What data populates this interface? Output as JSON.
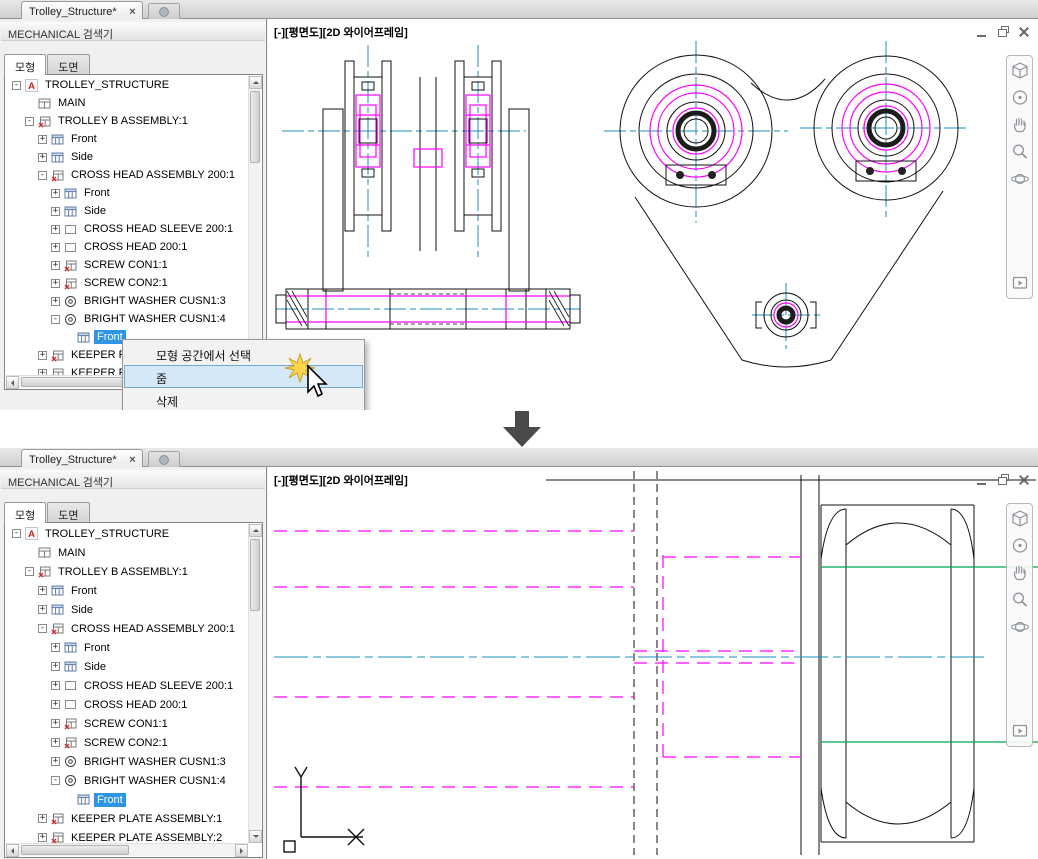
{
  "colors": {
    "magenta": "#ff00ff",
    "centerline": "#1b8fbe",
    "green": "#00a550",
    "selection": "#2e95e5",
    "menu_highlight": "#d5e8f8"
  },
  "tab": {
    "title": "Trolley_Structure*",
    "close_glyph": "×"
  },
  "browser": {
    "title": "MECHANICAL 검색기",
    "tabs": [
      {
        "label": "모형",
        "active": true
      },
      {
        "label": "도면",
        "active": false
      }
    ],
    "tree": [
      {
        "label": "TROLLEY_STRUCTURE",
        "level": 0,
        "toggle": "minus",
        "icon": "dwg-file-icon",
        "selected": false
      },
      {
        "label": "MAIN",
        "level": 1,
        "toggle": null,
        "icon": "layout-icon",
        "selected": false
      },
      {
        "label": "TROLLEY B ASSEMBLY:1",
        "level": 1,
        "toggle": "minus",
        "icon": "assembly-icon",
        "selected": false
      },
      {
        "label": "Front",
        "level": 2,
        "toggle": "plus",
        "icon": "view-icon",
        "selected": false
      },
      {
        "label": "Side",
        "level": 2,
        "toggle": "plus",
        "icon": "view-icon",
        "selected": false
      },
      {
        "label": "CROSS HEAD ASSEMBLY 200:1",
        "level": 2,
        "toggle": "minus",
        "icon": "assembly-icon",
        "selected": false
      },
      {
        "label": "Front",
        "level": 3,
        "toggle": "plus",
        "icon": "view-icon",
        "selected": false
      },
      {
        "label": "Side",
        "level": 3,
        "toggle": "plus",
        "icon": "view-icon",
        "selected": false
      },
      {
        "label": "CROSS HEAD SLEEVE 200:1",
        "level": 3,
        "toggle": "plus",
        "icon": "part-icon",
        "selected": false
      },
      {
        "label": "CROSS HEAD 200:1",
        "level": 3,
        "toggle": "plus",
        "icon": "part-icon",
        "selected": false
      },
      {
        "label": "SCREW CON1:1",
        "level": 3,
        "toggle": "plus",
        "icon": "assembly-icon",
        "selected": false
      },
      {
        "label": "SCREW CON2:1",
        "level": 3,
        "toggle": "plus",
        "icon": "assembly-icon",
        "selected": false
      },
      {
        "label": "BRIGHT WASHER CUSN1:3",
        "level": 3,
        "toggle": "plus",
        "icon": "washer-icon",
        "selected": false
      },
      {
        "label": "BRIGHT WASHER CUSN1:4",
        "level": 3,
        "toggle": "minus",
        "icon": "washer-icon",
        "selected": false
      },
      {
        "label": "Front",
        "level": 4,
        "toggle": null,
        "icon": "view-icon",
        "selected": true
      },
      {
        "label": "KEEPER PLATE ASSEMBLY:1",
        "level": 2,
        "toggle": "plus",
        "icon": "assembly-icon",
        "selected": false
      },
      {
        "label": "KEEPER PLATE ASSEMBLY:2",
        "level": 2,
        "toggle": "plus",
        "icon": "assembly-icon",
        "selected": false
      }
    ]
  },
  "viewport": {
    "label": "[-][평면도][2D 와이어프레임]",
    "navbar_icons": [
      "view-cube-icon",
      "navigation-wheel-icon",
      "pan-hand-icon",
      "zoom-icon",
      "orbit-icon",
      "show-motion-icon"
    ]
  },
  "context_menu": {
    "items": [
      {
        "label": "모형 공간에서 선택",
        "highlighted": false
      },
      {
        "label": "줌",
        "highlighted": true
      },
      {
        "label": "삭제",
        "highlighted": false
      }
    ]
  }
}
